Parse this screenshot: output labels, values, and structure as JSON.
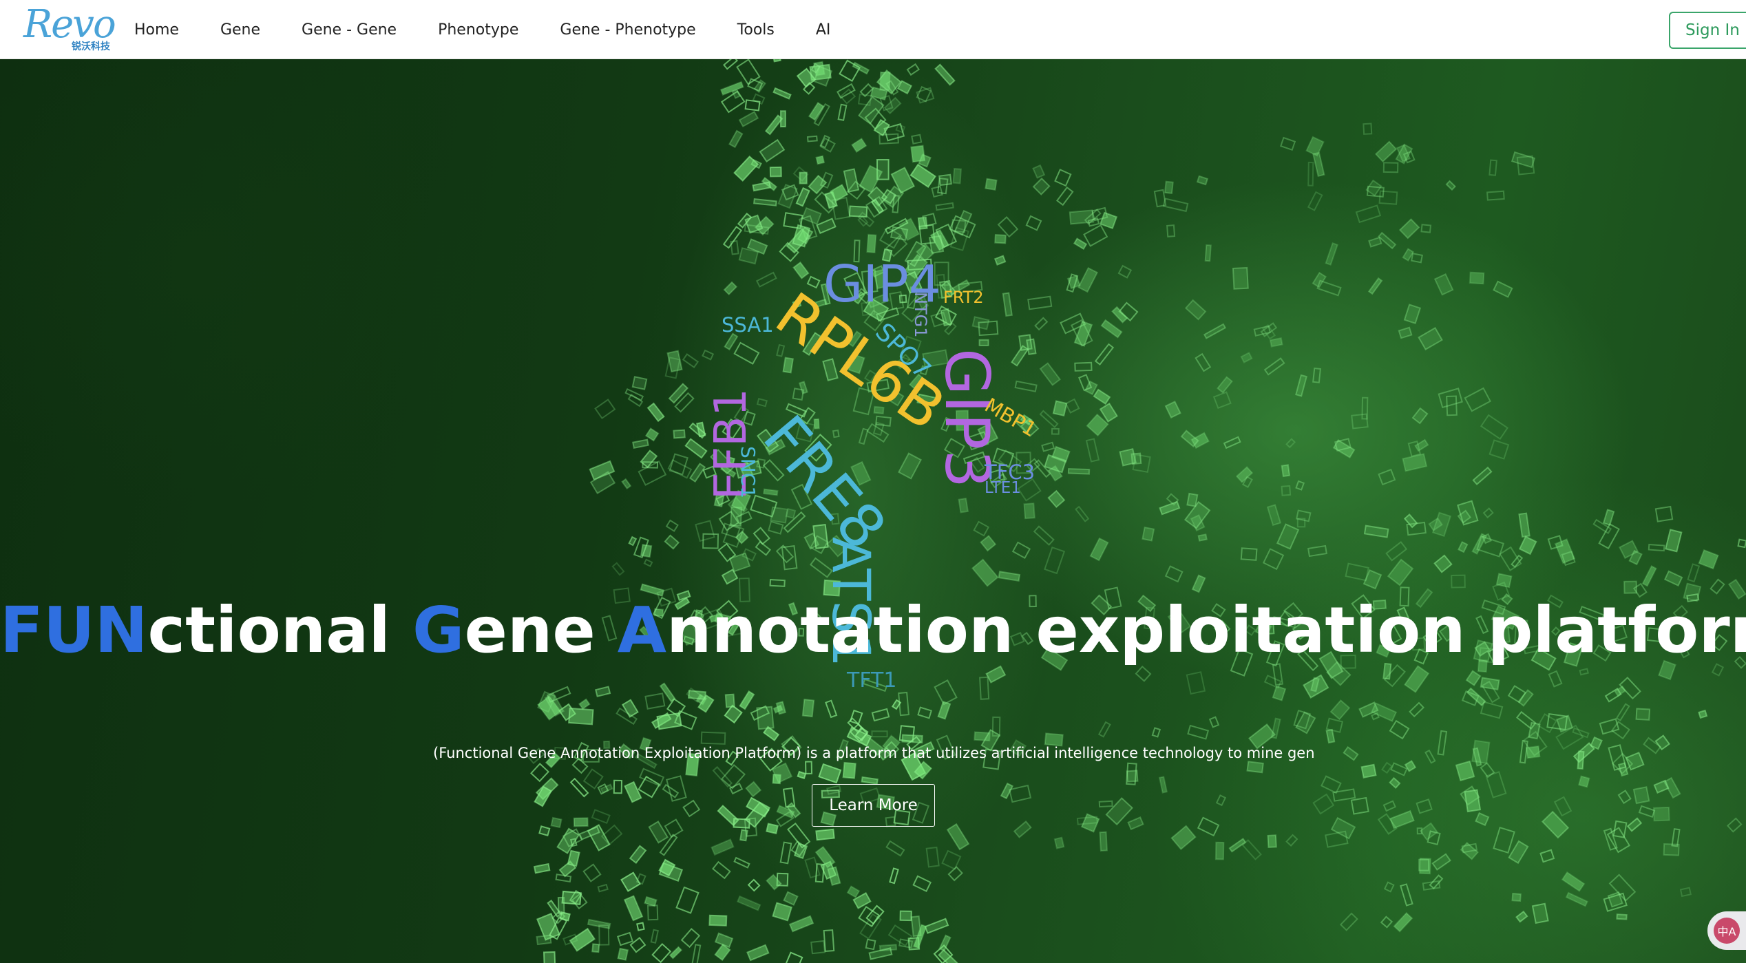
{
  "logo": {
    "text": "Revo",
    "subtitle": "锐沃科技"
  },
  "nav": {
    "items": [
      "Home",
      "Gene",
      "Gene - Gene",
      "Phenotype",
      "Gene - Phenotype",
      "Tools",
      "AI"
    ],
    "sign_in_label": "Sign In"
  },
  "hero": {
    "wordcloud": [
      {
        "text": "GIP4",
        "color": "#6b8ee0"
      },
      {
        "text": "FRT2",
        "color": "#f2c12e"
      },
      {
        "text": "RPL6B",
        "color": "#f2c12e"
      },
      {
        "text": "SSA1",
        "color": "#4cb8d8"
      },
      {
        "text": "NTG1",
        "color": "#8a9ad8"
      },
      {
        "text": "SPO7",
        "color": "#4cb8d8"
      },
      {
        "text": "GIP3",
        "color": "#b267e0"
      },
      {
        "text": "MBP1",
        "color": "#f2c12e"
      },
      {
        "text": "EFB1",
        "color": "#b267e0"
      },
      {
        "text": "SNC1",
        "color": "#4cb8d8"
      },
      {
        "text": "FRE8",
        "color": "#4cb8d8"
      },
      {
        "text": "TFC3",
        "color": "#6b8ee0"
      },
      {
        "text": "LTE1",
        "color": "#6b8ee0"
      },
      {
        "text": "ATS1",
        "color": "#4cb8d8"
      },
      {
        "text": "TFT1",
        "color": "#4cb8d8"
      }
    ],
    "headline": {
      "part1_accent": "FUN",
      "part1_rest": "ctional ",
      "part2_accent": "G",
      "part2_rest": "ene ",
      "part3_accent": "A",
      "part3_rest": "nnotation exploitation platform"
    },
    "subline": "A (Functional Gene Annotation Exploitation Platform) is a platform that utilizes artificial intelligence technology to mine gene fur",
    "learn_more_label": "Learn More",
    "accent_color": "#2f6fe0"
  },
  "translate_icon_label": "中A"
}
